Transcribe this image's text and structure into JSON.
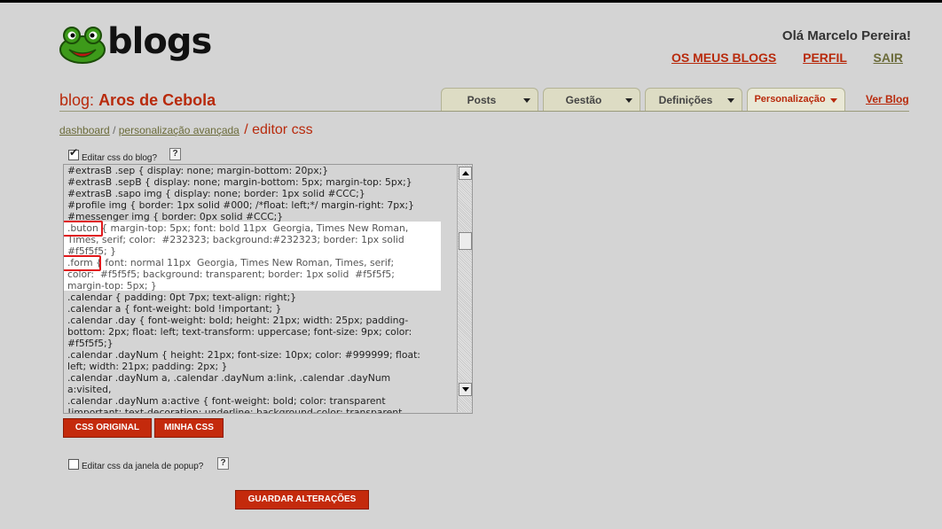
{
  "brand": {
    "name": "blogs",
    "logo_icon": "frog-icon"
  },
  "header": {
    "greeting": "Olá Marcelo Pereira!",
    "nav": [
      "OS MEUS BLOGS",
      "PERFIL",
      "SAIR"
    ]
  },
  "blog": {
    "prefix": "blog:",
    "name": "Aros de Cebola"
  },
  "tabs": [
    {
      "label": "Posts"
    },
    {
      "label": "Gestão"
    },
    {
      "label": "Definições"
    },
    {
      "label": "Personalização"
    }
  ],
  "ver_blog": "Ver Blog",
  "breadcrumb": {
    "items": [
      "dashboard",
      "personalização avançada"
    ],
    "sep": "/",
    "current": "/ editor css"
  },
  "edit_css": {
    "label": "Editar css do blog?",
    "checked": true,
    "help": "?"
  },
  "editor": {
    "lines": [
      "#extrasB .sep { display: none; margin-bottom: 20px;}",
      "#extrasB .sepB { display: none; margin-bottom: 5px; margin-top: 5px;}",
      "#extrasB .sapo img { display: none; border: 1px solid #CCC;}",
      "#profile img { border: 1px solid #000; /*float: left;*/ margin-right: 7px;}",
      "#messenger img { border: 0px solid #CCC;}",
      ".buton { margin-top: 5px; font: bold 11px  Georgia, Times New Roman,",
      "Times, serif; color:  #232323; background:#232323; border: 1px solid",
      "#f5f5f5; }",
      ".form { font: normal 11px  Georgia, Times New Roman, Times, serif;",
      "color:  #f5f5f5; background: transparent; border: 1px solid  #f5f5f5;",
      "margin-top: 5px; }",
      ".calendar { padding: 0pt 7px; text-align: right;}",
      ".calendar a { font-weight: bold !important; }",
      ".calendar .day { font-weight: bold; height: 21px; width: 25px; padding-",
      "bottom: 2px; float: left; text-transform: uppercase; font-size: 9px; color:",
      "#f5f5f5;}",
      ".calendar .dayNum { height: 21px; font-size: 10px; color: #999999; float:",
      "left; width: 21px; padding: 2px; }",
      ".calendar .dayNum a, .calendar .dayNum a:link, .calendar .dayNum",
      "a:visited,",
      ".calendar .dayNum a:active { font-weight: bold; color: transparent",
      "!important; text-decoration: underline; background-color: transparent"
    ]
  },
  "buttons": {
    "original": "CSS ORIGINAL",
    "mine": "MINHA CSS",
    "save": "GUARDAR ALTERAÇÕES"
  },
  "edit_popup": {
    "label": "Editar css da janela de popup?",
    "checked": false,
    "help": "?"
  },
  "colors": {
    "accent": "#c42a0c",
    "link_red": "#b82a0c",
    "olive": "#6b6b3a",
    "background": "#d4d4d4"
  }
}
